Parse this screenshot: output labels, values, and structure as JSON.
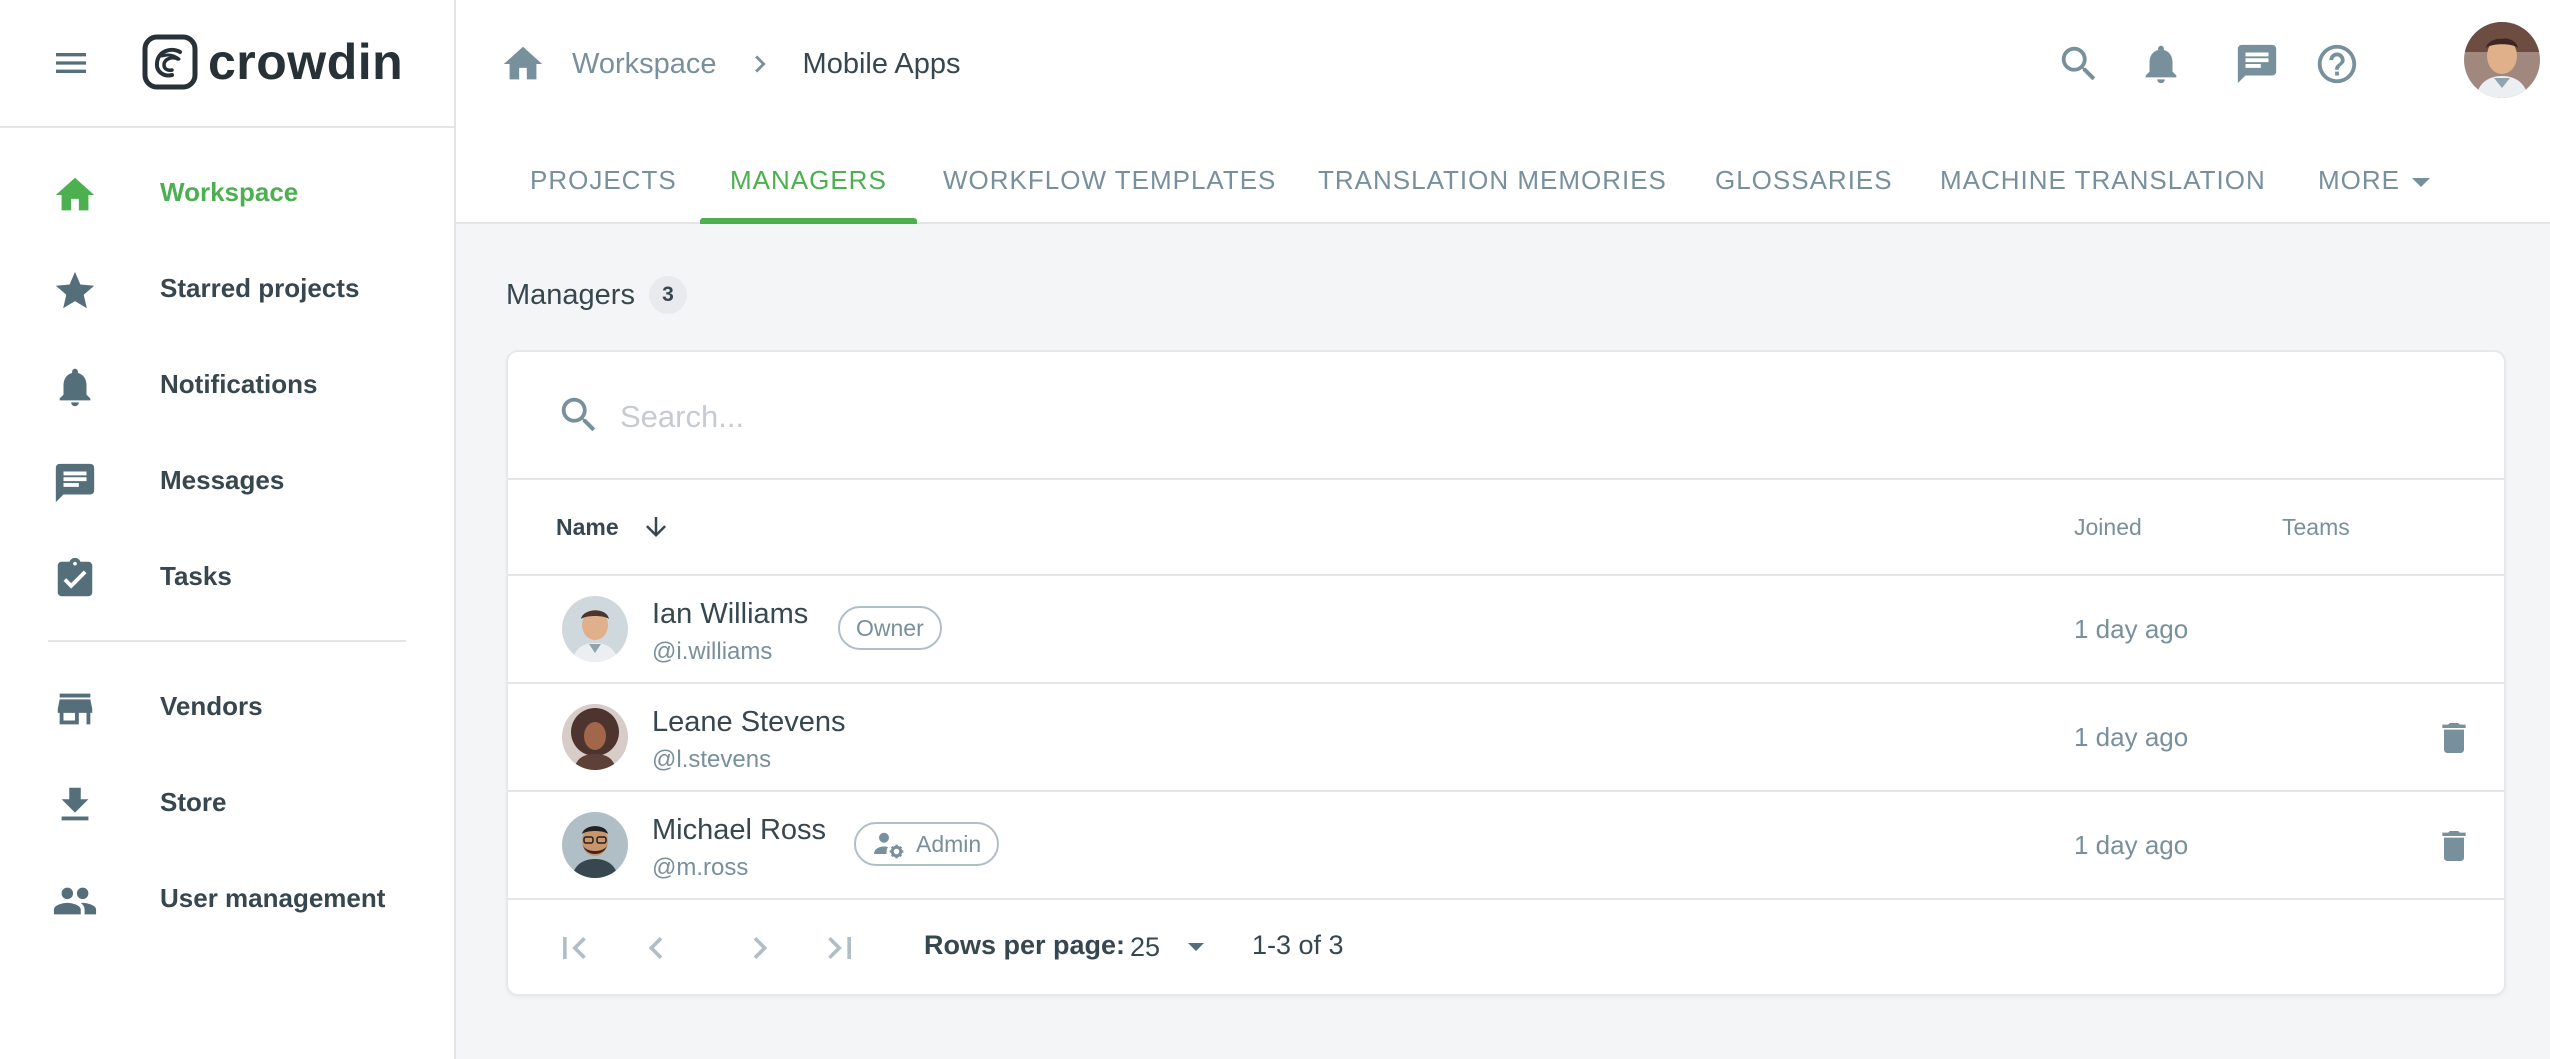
{
  "brand": {
    "name": "crowdin",
    "accent": "#4caf50"
  },
  "sidebar": {
    "items": [
      {
        "label": "Workspace",
        "icon": "home-icon"
      },
      {
        "label": "Starred projects",
        "icon": "star-icon"
      },
      {
        "label": "Notifications",
        "icon": "bell-icon"
      },
      {
        "label": "Messages",
        "icon": "message-icon"
      },
      {
        "label": "Tasks",
        "icon": "tasks-icon"
      },
      {
        "label": "Vendors",
        "icon": "store-front-icon"
      },
      {
        "label": "Store",
        "icon": "download-icon"
      },
      {
        "label": "User management",
        "icon": "users-icon"
      }
    ]
  },
  "breadcrumb": {
    "root": "Workspace",
    "current": "Mobile Apps"
  },
  "tabs": [
    {
      "label": "PROJECTS"
    },
    {
      "label": "MANAGERS"
    },
    {
      "label": "WORKFLOW TEMPLATES"
    },
    {
      "label": "TRANSLATION MEMORIES"
    },
    {
      "label": "GLOSSARIES"
    },
    {
      "label": "MACHINE TRANSLATION"
    },
    {
      "label": "MORE"
    }
  ],
  "main": {
    "title": "Managers",
    "count": "3",
    "search": {
      "placeholder": "Search..."
    },
    "columns": {
      "name": "Name",
      "joined": "Joined",
      "teams": "Teams"
    },
    "rows": [
      {
        "name": "Ian Williams",
        "handle": "@i.williams",
        "role": "Owner",
        "joined": "1 day ago"
      },
      {
        "name": "Leane Stevens",
        "handle": "@l.stevens",
        "role": "",
        "joined": "1 day ago"
      },
      {
        "name": "Michael Ross",
        "handle": "@m.ross",
        "role": "Admin",
        "joined": "1 day ago"
      }
    ],
    "pagination": {
      "rows_label": "Rows per page:",
      "rows_value": "25",
      "range": "1-3 of 3"
    }
  }
}
